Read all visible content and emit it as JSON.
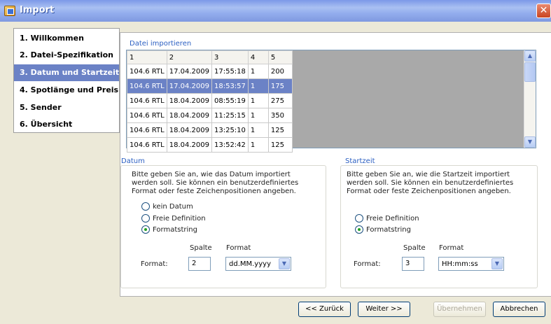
{
  "window": {
    "title": "Import",
    "close_glyph": "✕"
  },
  "nav": {
    "items": [
      {
        "label": "1. Willkommen",
        "active": false
      },
      {
        "label": "2. Datei-Spezifikation",
        "active": false
      },
      {
        "label": "3. Datum und Startzeit",
        "active": true
      },
      {
        "label": "4. Spotlänge und Preis",
        "active": false
      },
      {
        "label": "5. Sender",
        "active": false
      },
      {
        "label": "6. Übersicht",
        "active": false
      }
    ]
  },
  "import_section": {
    "title": "Datei importieren",
    "columns": [
      "1",
      "2",
      "3",
      "4",
      "5"
    ],
    "rows": [
      [
        "104.6 RTL",
        "17.04.2009",
        "17:55:18",
        "1",
        "200"
      ],
      [
        "104.6 RTL",
        "17.04.2009",
        "18:53:57",
        "1",
        "175"
      ],
      [
        "104.6 RTL",
        "18.04.2009",
        "08:55:19",
        "1",
        "275"
      ],
      [
        "104.6 RTL",
        "18.04.2009",
        "11:25:15",
        "1",
        "350"
      ],
      [
        "104.6 RTL",
        "18.04.2009",
        "13:25:10",
        "1",
        "125"
      ],
      [
        "104.6 RTL",
        "18.04.2009",
        "13:52:42",
        "1",
        "125"
      ]
    ],
    "selected_row": 1
  },
  "datum": {
    "title": "Datum",
    "description": "Bitte geben Sie an, wie das Datum importiert werden soll. Sie können ein benutzerdefiniertes Format oder feste Zeichenpositionen angeben.",
    "options": [
      {
        "label": "kein Datum",
        "checked": false
      },
      {
        "label": "Freie Definition",
        "checked": false
      },
      {
        "label": "Formatstring",
        "checked": true
      }
    ],
    "col_header_spalte": "Spalte",
    "col_header_format": "Format",
    "row_label": "Format:",
    "spalte_value": "2",
    "format_value": "dd.MM.yyyy"
  },
  "startzeit": {
    "title": "Startzeit",
    "description": "Bitte geben Sie an, wie die Startzeit importiert werden soll. Sie können ein benutzerdefiniertes Format oder feste Zeichenpositionen angeben.",
    "options": [
      {
        "label": "Freie Definition",
        "checked": false
      },
      {
        "label": "Formatstring",
        "checked": true
      }
    ],
    "col_header_spalte": "Spalte",
    "col_header_format": "Format",
    "row_label": "Format:",
    "spalte_value": "3",
    "format_value": "HH:mm:ss"
  },
  "buttons": {
    "back": "<< Zurück",
    "next": "Weiter >>",
    "apply": "Übernehmen",
    "cancel": "Abbrechen"
  },
  "icons": {
    "scroll_up": "▲",
    "scroll_down": "▼",
    "dropdown": "▼"
  },
  "colors": {
    "selection": "#6b82c6",
    "section_label": "#2b5fc2"
  }
}
